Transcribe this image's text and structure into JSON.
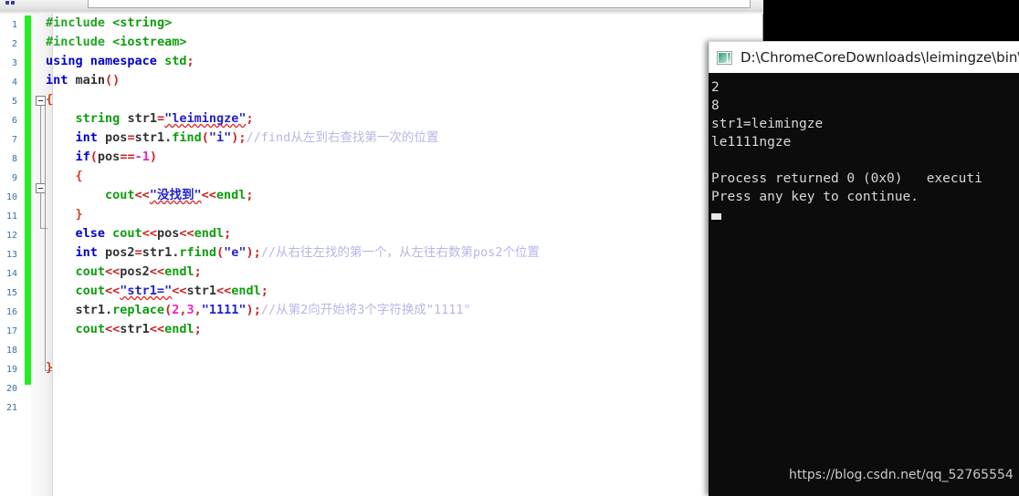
{
  "ide": {
    "toolbar": {
      "dots_label": "",
      "field_value": ""
    },
    "gutter": {
      "line_numbers": [
        "1",
        "2",
        "3",
        "4",
        "5",
        "6",
        "7",
        "8",
        "9",
        "10",
        "11",
        "12",
        "13",
        "14",
        "15",
        "16",
        "17",
        "18",
        "19",
        "20",
        "21"
      ]
    },
    "code_lines": [
      {
        "indent": 0,
        "tokens": [
          {
            "t": "#include",
            "c": "pp"
          },
          {
            "t": " ",
            "c": "id"
          },
          {
            "t": "<string>",
            "c": "ty"
          }
        ]
      },
      {
        "indent": 0,
        "tokens": [
          {
            "t": "#include",
            "c": "pp"
          },
          {
            "t": " ",
            "c": "id"
          },
          {
            "t": "<iostream>",
            "c": "ty"
          }
        ]
      },
      {
        "indent": 0,
        "tokens": [
          {
            "t": "using",
            "c": "k"
          },
          {
            "t": " ",
            "c": "id"
          },
          {
            "t": "namespace",
            "c": "k"
          },
          {
            "t": " ",
            "c": "id"
          },
          {
            "t": "std",
            "c": "ty"
          },
          {
            "t": ";",
            "c": "pu"
          }
        ]
      },
      {
        "indent": 0,
        "tokens": [
          {
            "t": "int",
            "c": "k"
          },
          {
            "t": " ",
            "c": "id"
          },
          {
            "t": "main",
            "c": "id"
          },
          {
            "t": "()",
            "c": "pu"
          }
        ]
      },
      {
        "indent": 0,
        "tokens": [
          {
            "t": "{",
            "c": "br"
          }
        ]
      },
      {
        "indent": 1,
        "tokens": [
          {
            "t": "string",
            "c": "ty"
          },
          {
            "t": " ",
            "c": "id"
          },
          {
            "t": "str1",
            "c": "id"
          },
          {
            "t": "=",
            "c": "op"
          },
          {
            "t": "\"leimingze\"",
            "c": "st sp"
          },
          {
            "t": ";",
            "c": "pu"
          }
        ]
      },
      {
        "indent": 1,
        "tokens": [
          {
            "t": "int",
            "c": "k"
          },
          {
            "t": " ",
            "c": "id"
          },
          {
            "t": "pos",
            "c": "id"
          },
          {
            "t": "=",
            "c": "op"
          },
          {
            "t": "str1.",
            "c": "id"
          },
          {
            "t": "find",
            "c": "fn"
          },
          {
            "t": "(",
            "c": "pu"
          },
          {
            "t": "\"i\"",
            "c": "st"
          },
          {
            "t": ")",
            "c": "pu"
          },
          {
            "t": ";",
            "c": "pu"
          },
          {
            "t": "//find从左到右查找第一次的位置",
            "c": "cm"
          }
        ]
      },
      {
        "indent": 1,
        "tokens": [
          {
            "t": "if",
            "c": "k"
          },
          {
            "t": "(",
            "c": "pu"
          },
          {
            "t": "pos",
            "c": "id"
          },
          {
            "t": "==",
            "c": "op"
          },
          {
            "t": "-1",
            "c": "num"
          },
          {
            "t": ")",
            "c": "pu"
          }
        ]
      },
      {
        "indent": 1,
        "tokens": [
          {
            "t": "{",
            "c": "br"
          }
        ]
      },
      {
        "indent": 2,
        "tokens": [
          {
            "t": "cout",
            "c": "fn"
          },
          {
            "t": "<<",
            "c": "op"
          },
          {
            "t": "\"没找到\"",
            "c": "st sp"
          },
          {
            "t": "<<",
            "c": "op"
          },
          {
            "t": "endl",
            "c": "fn"
          },
          {
            "t": ";",
            "c": "pu"
          }
        ]
      },
      {
        "indent": 1,
        "tokens": [
          {
            "t": "}",
            "c": "br"
          }
        ]
      },
      {
        "indent": 1,
        "tokens": [
          {
            "t": "else",
            "c": "k"
          },
          {
            "t": " ",
            "c": "id"
          },
          {
            "t": "cout",
            "c": "fn"
          },
          {
            "t": "<<",
            "c": "op"
          },
          {
            "t": "pos",
            "c": "id"
          },
          {
            "t": "<<",
            "c": "op"
          },
          {
            "t": "endl",
            "c": "fn"
          },
          {
            "t": ";",
            "c": "pu"
          }
        ]
      },
      {
        "indent": 1,
        "tokens": [
          {
            "t": "int",
            "c": "k"
          },
          {
            "t": " ",
            "c": "id"
          },
          {
            "t": "pos2",
            "c": "id"
          },
          {
            "t": "=",
            "c": "op"
          },
          {
            "t": "str1.",
            "c": "id"
          },
          {
            "t": "rfind",
            "c": "fn"
          },
          {
            "t": "(",
            "c": "pu"
          },
          {
            "t": "\"e\"",
            "c": "st"
          },
          {
            "t": ")",
            "c": "pu"
          },
          {
            "t": ";",
            "c": "pu"
          },
          {
            "t": "//从右往左找的第一个，从左往右数第pos2个位置",
            "c": "cm"
          }
        ]
      },
      {
        "indent": 1,
        "tokens": [
          {
            "t": "cout",
            "c": "fn"
          },
          {
            "t": "<<",
            "c": "op"
          },
          {
            "t": "pos2",
            "c": "id"
          },
          {
            "t": "<<",
            "c": "op"
          },
          {
            "t": "endl",
            "c": "fn"
          },
          {
            "t": ";",
            "c": "pu"
          }
        ]
      },
      {
        "indent": 1,
        "tokens": [
          {
            "t": "cout",
            "c": "fn"
          },
          {
            "t": "<<",
            "c": "op"
          },
          {
            "t": "\"str1=\"",
            "c": "st sp"
          },
          {
            "t": "<<",
            "c": "op"
          },
          {
            "t": "str1",
            "c": "id"
          },
          {
            "t": "<<",
            "c": "op"
          },
          {
            "t": "endl",
            "c": "fn"
          },
          {
            "t": ";",
            "c": "pu"
          }
        ]
      },
      {
        "indent": 1,
        "tokens": [
          {
            "t": "str1.",
            "c": "id"
          },
          {
            "t": "replace",
            "c": "fn"
          },
          {
            "t": "(",
            "c": "pu"
          },
          {
            "t": "2",
            "c": "num"
          },
          {
            "t": ",",
            "c": "pu"
          },
          {
            "t": "3",
            "c": "num"
          },
          {
            "t": ",",
            "c": "pu"
          },
          {
            "t": "\"1111\"",
            "c": "st"
          },
          {
            "t": ")",
            "c": "pu"
          },
          {
            "t": ";",
            "c": "pu"
          },
          {
            "t": "//从第2向开始将3个字符换成\"1111\"",
            "c": "cm"
          }
        ]
      },
      {
        "indent": 1,
        "tokens": [
          {
            "t": "cout",
            "c": "fn"
          },
          {
            "t": "<<",
            "c": "op"
          },
          {
            "t": "str1",
            "c": "id"
          },
          {
            "t": "<<",
            "c": "op"
          },
          {
            "t": "endl",
            "c": "fn"
          },
          {
            "t": ";",
            "c": "pu"
          }
        ]
      },
      {
        "indent": 0,
        "tokens": []
      },
      {
        "indent": 0,
        "tokens": [
          {
            "t": "}",
            "c": "br"
          }
        ]
      }
    ]
  },
  "console": {
    "title": "D:\\ChromeCoreDownloads\\leimingze\\bin\\",
    "icon": "console-app-icon",
    "output_lines": [
      "2",
      "8",
      "str1=leimingze",
      "le1111ngze",
      "",
      "Process returned 0 (0x0)   executi",
      "Press any key to continue."
    ]
  },
  "watermark": {
    "text": "https://blog.csdn.net/qq_52765554"
  },
  "colors": {
    "change_bar": "#22ef22",
    "keyword": "#0000d0",
    "type": "#0d9e0d",
    "string": "#2222cc",
    "number": "#ee22cc",
    "comment": "#b6b6e8",
    "console_bg": "#0c0c0c"
  }
}
